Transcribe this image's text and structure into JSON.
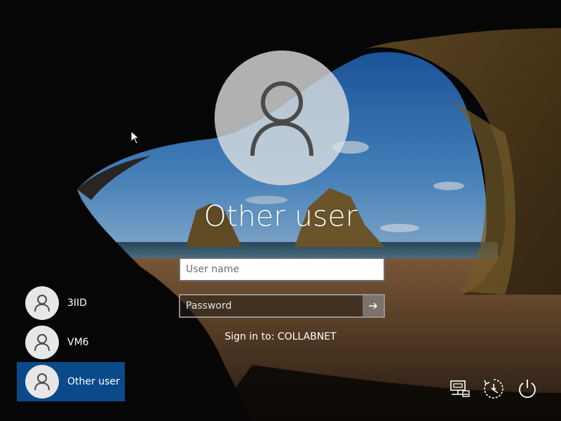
{
  "login": {
    "title": "Other user",
    "username_placeholder": "User name",
    "password_placeholder": "Password",
    "signin_to": "Sign in to: COLLABNET"
  },
  "users": [
    {
      "name": "3IID",
      "icon": "user-icon",
      "selected": false
    },
    {
      "name": "VM6",
      "icon": "user-icon",
      "selected": false
    },
    {
      "name": "Other user",
      "icon": "user-icon",
      "selected": true
    }
  ],
  "corner_icons": [
    "network-icon",
    "ease-of-access-icon",
    "power-icon"
  ],
  "colors": {
    "selected_user_bg": "#0a4a8a",
    "avatar_bg": "#e7e7e7",
    "text": "#ffffff"
  }
}
